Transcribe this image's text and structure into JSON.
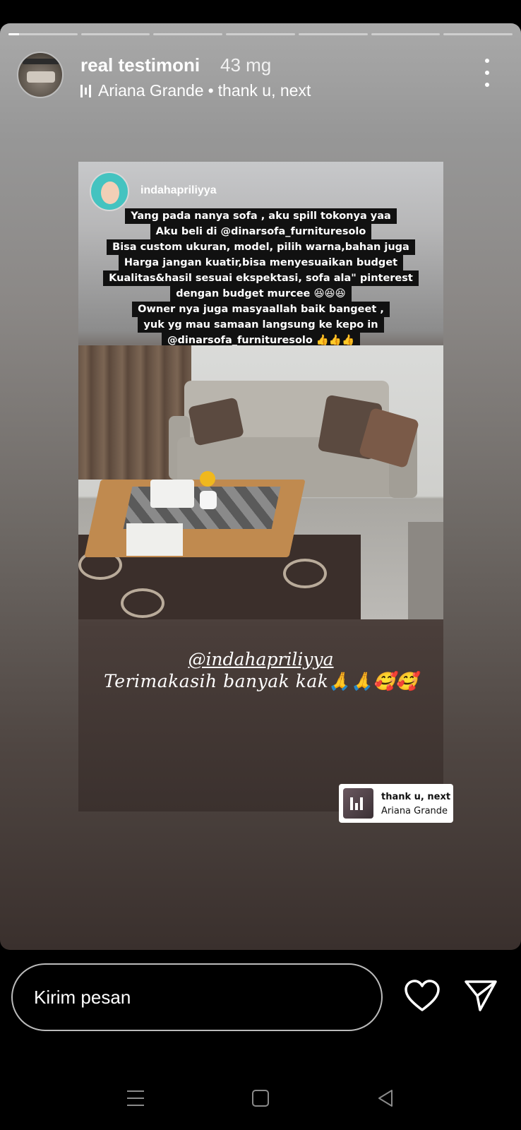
{
  "story": {
    "segments": [
      1,
      0,
      0,
      0,
      0,
      0,
      0
    ],
    "active_segment_progress": 0.15
  },
  "header": {
    "username": "real testimoni",
    "time": "43 mg",
    "music_artist": "Ariana Grande",
    "music_separator": "•",
    "music_song": "thank u, next",
    "more_icon": "more-vertical-icon"
  },
  "repost": {
    "username": "indahapriliyya",
    "caption_lines": [
      "Yang pada nanya sofa , aku spill tokonya yaa",
      "Aku beli di @dinarsofa_furnituresolo",
      "Bisa custom ukuran, model, pilih warna,bahan juga",
      "Harga jangan kuatir,bisa menyesuaikan budget",
      "Kualitas&hasil sesuai ekspektasi, sofa ala\" pinterest",
      "dengan budget  murcee 😆😆😆",
      "Owner nya juga masyaallah baik bangeet ,",
      "yuk yg mau samaan langsung ke kepo in",
      "@dinarsofa_furnituresolo 👍👍👍"
    ],
    "overlay_handle": "@indahapriliyya",
    "overlay_thanks": "Terimakasih banyak kak🙏🙏🥰🥰"
  },
  "music_sticker": {
    "song": "thank u, next",
    "artist": "Ariana Grande"
  },
  "reply": {
    "placeholder": "Kirim pesan"
  },
  "icons": {
    "like": "heart-icon",
    "share": "send-icon",
    "nav_menu": "recent-apps-icon",
    "nav_home": "home-icon",
    "nav_back": "back-icon"
  }
}
